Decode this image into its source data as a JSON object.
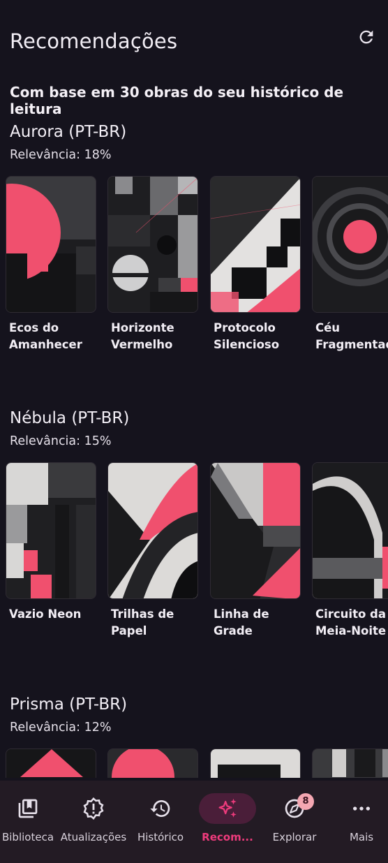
{
  "header": {
    "title": "Recomendações",
    "refresh_icon": "refresh-icon"
  },
  "subtitle": "Com base em 30 obras do seu histórico de leitura",
  "sections": [
    {
      "source": "Aurora (PT-BR)",
      "relevance": "Relevância: 18%",
      "books": [
        {
          "title": "Ecos do\nAmanhecer"
        },
        {
          "title": "Horizonte\nVermelho"
        },
        {
          "title": "Protocolo\nSilencioso"
        },
        {
          "title": "Céu\nFragmentado"
        }
      ]
    },
    {
      "source": "Nébula (PT-BR)",
      "relevance": "Relevância: 15%",
      "books": [
        {
          "title": "Vazio Neon"
        },
        {
          "title": "Trilhas de\nPapel"
        },
        {
          "title": "Linha de\nGrade"
        },
        {
          "title": "Circuito da\nMeia-Noite"
        }
      ]
    },
    {
      "source": "Prisma (PT-BR)",
      "relevance": "Relevância: 12%",
      "books": [
        {
          "title": ""
        },
        {
          "title": ""
        },
        {
          "title": ""
        },
        {
          "title": ""
        }
      ]
    }
  ],
  "nav": [
    {
      "label": "Biblioteca",
      "icon": "library-icon",
      "active": false
    },
    {
      "label": "Atualizações",
      "icon": "alert-badge-icon",
      "active": false
    },
    {
      "label": "Histórico",
      "icon": "history-icon",
      "active": false
    },
    {
      "label": "Recom...",
      "icon": "sparkles-icon",
      "active": true
    },
    {
      "label": "Explorar",
      "icon": "compass-icon",
      "active": false,
      "badge": "8"
    },
    {
      "label": "Mais",
      "icon": "more-dots-icon",
      "active": false
    }
  ],
  "colors": {
    "accent": "#ee3b7c",
    "cover_pink": "#f0506e",
    "background": "#15131d",
    "nav_background": "#231b24"
  }
}
